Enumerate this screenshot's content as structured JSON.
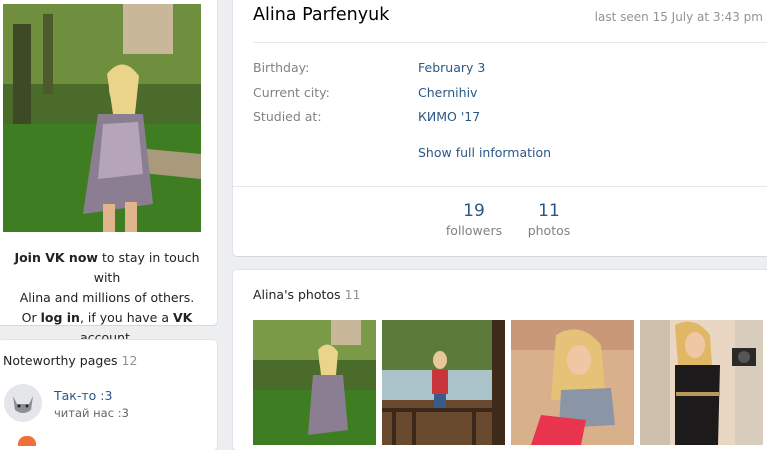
{
  "sidebar": {
    "join_vk": "Join VK now",
    "join_rest1": " to stay in touch with",
    "join_line2": "Alina and millions of others.",
    "join_or": "Or ",
    "log_in": "log in",
    "join_rest3": ", if you have a ",
    "vk": "VK",
    "join_end": " account.",
    "noteworthy": {
      "title": "Noteworthy pages",
      "count": "12",
      "items": [
        {
          "name": "Так-то :3",
          "subtitle": "читай нас :3"
        }
      ]
    }
  },
  "profile": {
    "name": "Alina Parfenyuk",
    "last_seen": "last seen 15 July at 3:43 pm",
    "info": [
      {
        "label": "Birthday:",
        "value": "February 3"
      },
      {
        "label": "Current city:",
        "value": "Chernihiv"
      },
      {
        "label": "Studied at:",
        "value": "КИМО '17"
      }
    ],
    "show_full": "Show full information",
    "counters": [
      {
        "num": "19",
        "label": "followers"
      },
      {
        "num": "11",
        "label": "photos"
      }
    ]
  },
  "photos": {
    "title": "Alina's photos",
    "count": "11"
  },
  "colors": {
    "link": "#2a5885",
    "label": "#828282",
    "background": "#edeef0"
  }
}
